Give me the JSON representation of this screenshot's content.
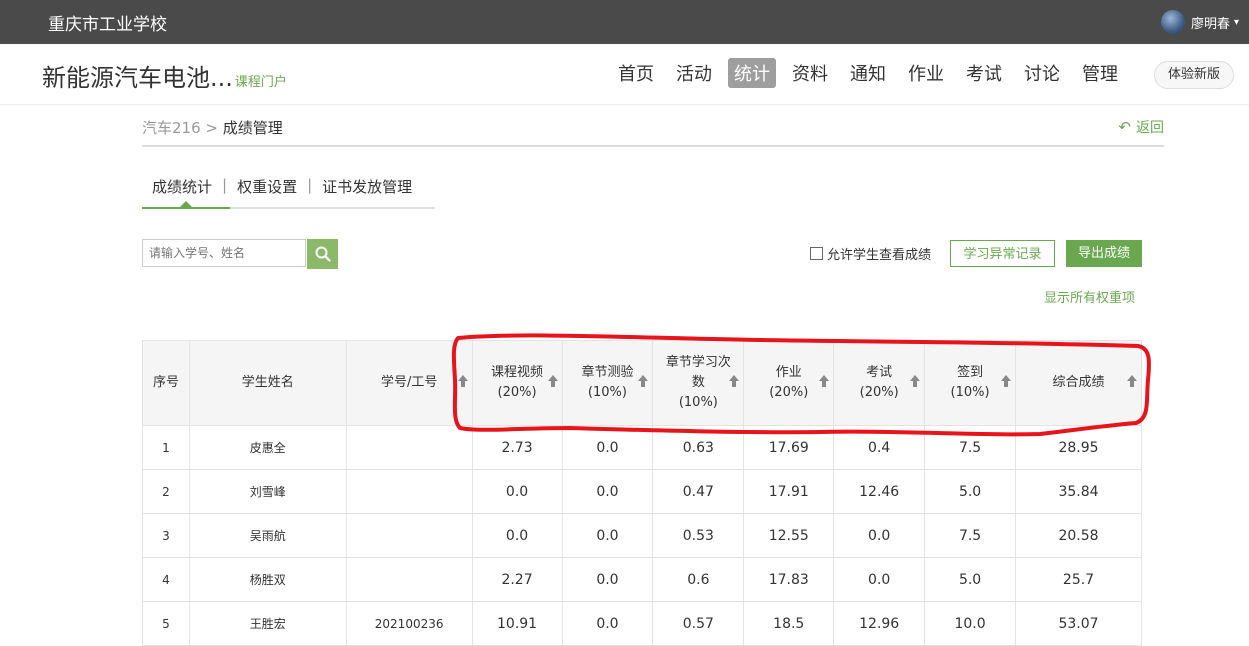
{
  "topbar": {
    "school": "重庆市工业学校",
    "user_name": "廖明春"
  },
  "header": {
    "course_title": "新能源汽车电池...",
    "course_portal": "课程门户",
    "nav": [
      "首页",
      "活动",
      "统计",
      "资料",
      "通知",
      "作业",
      "考试",
      "讨论",
      "管理"
    ],
    "active_nav": "统计",
    "new_version_label": "体验新版"
  },
  "breadcrumb": {
    "class_name": "汽车216",
    "separator": ">",
    "current": "成绩管理",
    "back_label": "返回"
  },
  "subtabs": {
    "items": [
      "成绩统计",
      "权重设置",
      "证书发放管理"
    ],
    "separator": "|",
    "active": "成绩统计"
  },
  "toolbar": {
    "search_placeholder": "请输入学号、姓名",
    "allow_label": "允许学生查看成绩",
    "abnormal_label": "学习异常记录",
    "export_label": "导出成绩",
    "show_weights_label": "显示所有权重项"
  },
  "table": {
    "headers": [
      {
        "l1": "序号",
        "l2": "",
        "l3": "",
        "sort": false
      },
      {
        "l1": "学生姓名",
        "l2": "",
        "l3": "",
        "sort": false
      },
      {
        "l1": "学号/工号",
        "l2": "",
        "l3": "",
        "sort": true
      },
      {
        "l1": "课程视频",
        "l2": "(20%)",
        "l3": "",
        "sort": true
      },
      {
        "l1": "章节测验",
        "l2": "(10%)",
        "l3": "",
        "sort": true
      },
      {
        "l1": "章节学习次",
        "l2": "数",
        "l3": "(10%)",
        "sort": true
      },
      {
        "l1": "作业",
        "l2": "(20%)",
        "l3": "",
        "sort": true
      },
      {
        "l1": "考试",
        "l2": "(20%)",
        "l3": "",
        "sort": true
      },
      {
        "l1": "签到",
        "l2": "(10%)",
        "l3": "",
        "sort": true
      },
      {
        "l1": "综合成绩",
        "l2": "",
        "l3": "",
        "sort": true
      }
    ],
    "rows": [
      [
        "1",
        "皮惠全",
        "",
        "2.73",
        "0.0",
        "0.63",
        "17.69",
        "0.4",
        "7.5",
        "28.95"
      ],
      [
        "2",
        "刘雪峰",
        "",
        "0.0",
        "0.0",
        "0.47",
        "17.91",
        "12.46",
        "5.0",
        "35.84"
      ],
      [
        "3",
        "吴雨航",
        "",
        "0.0",
        "0.0",
        "0.53",
        "12.55",
        "0.0",
        "7.5",
        "20.58"
      ],
      [
        "4",
        "杨胜双",
        "",
        "2.27",
        "0.0",
        "0.6",
        "17.83",
        "0.0",
        "5.0",
        "25.7"
      ],
      [
        "5",
        "王胜宏",
        "202100236",
        "10.91",
        "0.0",
        "0.57",
        "18.5",
        "12.96",
        "10.0",
        "53.07"
      ]
    ]
  },
  "colors": {
    "accent": "#6aa84f",
    "topbar": "#4a4a4a",
    "annotation": "#e8141c"
  }
}
